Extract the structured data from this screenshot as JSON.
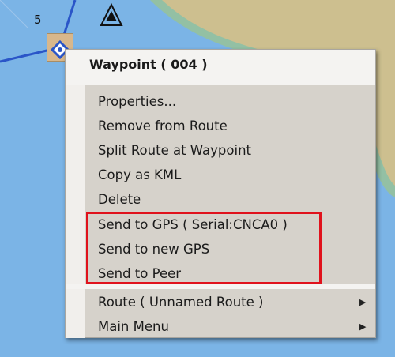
{
  "waypoint_label": "5",
  "menu": {
    "title": "Waypoint ( 004 )",
    "items": [
      {
        "label": "Properties..."
      },
      {
        "label": "Remove from Route"
      },
      {
        "label": "Split Route at Waypoint"
      },
      {
        "label": "Copy as KML"
      },
      {
        "label": "Delete"
      },
      {
        "label": "Send to GPS ( Serial:CNCA0 )"
      },
      {
        "label": "Send to new GPS"
      },
      {
        "label": "Send to Peer"
      }
    ],
    "submenus": [
      {
        "label": "Route ( Unnamed Route )",
        "arrow": "▶"
      },
      {
        "label": "Main Menu",
        "arrow": "▶"
      }
    ]
  },
  "colors": {
    "water": "#7bb4e6",
    "land": "#cdbf8f",
    "shallow": "#93c0a4",
    "route_line": "#2a55c8",
    "highlight": "#e0121c",
    "menu_bg": "#d6d2cb"
  },
  "icons": {
    "waypoint": "waypoint-diamond-icon",
    "beacon": "triangle-beacon-icon",
    "submenu": "chevron-right-icon"
  }
}
